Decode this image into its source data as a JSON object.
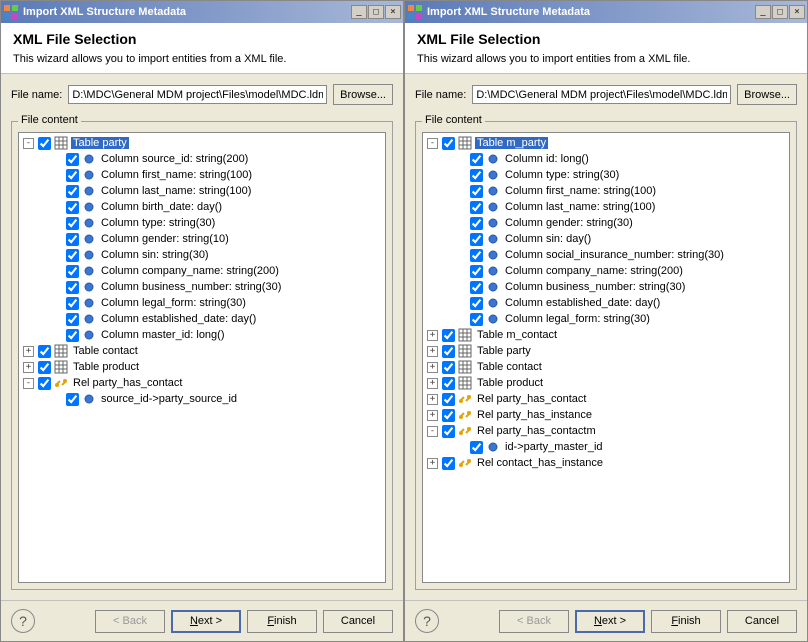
{
  "title": "Import XML Structure Metadata",
  "header": {
    "title": "XML File Selection",
    "sub": "This wizard allows you to import entities from a XML file."
  },
  "file": {
    "label": "File name:",
    "path": "D:\\MDC\\General MDM project\\Files\\model\\MDC.ldm",
    "browse": "Browse..."
  },
  "group": "File content",
  "footer": {
    "back": "< Back",
    "next": "Next >",
    "finish": "Finish",
    "cancel": "Cancel"
  },
  "left": {
    "root": "Table party",
    "cols": [
      "Column source_id: string(200)",
      "Column first_name: string(100)",
      "Column last_name: string(100)",
      "Column birth_date: day()",
      "Column type: string(30)",
      "Column gender: string(10)",
      "Column sin: string(30)",
      "Column company_name: string(200)",
      "Column business_number: string(30)",
      "Column legal_form: string(30)",
      "Column established_date: day()",
      "Column master_id: long()"
    ],
    "siblings": [
      {
        "label": "Table contact",
        "type": "tbl",
        "toggle": "+"
      },
      {
        "label": "Table product",
        "type": "tbl",
        "toggle": "+"
      },
      {
        "label": "Rel party_has_contact",
        "type": "rel",
        "toggle": "-"
      }
    ],
    "relchild": "source_id->party_source_id"
  },
  "right": {
    "root": "Table m_party",
    "cols": [
      "Column id: long()",
      "Column type: string(30)",
      "Column first_name: string(100)",
      "Column last_name: string(100)",
      "Column gender: string(30)",
      "Column sin: day()",
      "Column social_insurance_number: string(30)",
      "Column company_name: string(200)",
      "Column business_number: string(30)",
      "Column established_date: day()",
      "Column legal_form: string(30)"
    ],
    "siblings": [
      {
        "label": "Table m_contact",
        "type": "tbl",
        "toggle": "+"
      },
      {
        "label": "Table party",
        "type": "tbl",
        "toggle": "+"
      },
      {
        "label": "Table contact",
        "type": "tbl",
        "toggle": "+"
      },
      {
        "label": "Table product",
        "type": "tbl",
        "toggle": "+"
      },
      {
        "label": "Rel party_has_contact",
        "type": "rel",
        "toggle": "+"
      },
      {
        "label": "Rel party_has_instance",
        "type": "rel",
        "toggle": "+"
      },
      {
        "label": "Rel party_has_contactm",
        "type": "rel",
        "toggle": "-"
      }
    ],
    "relchild": "id->party_master_id",
    "after": [
      {
        "label": "Rel contact_has_instance",
        "type": "rel",
        "toggle": "+"
      }
    ]
  }
}
